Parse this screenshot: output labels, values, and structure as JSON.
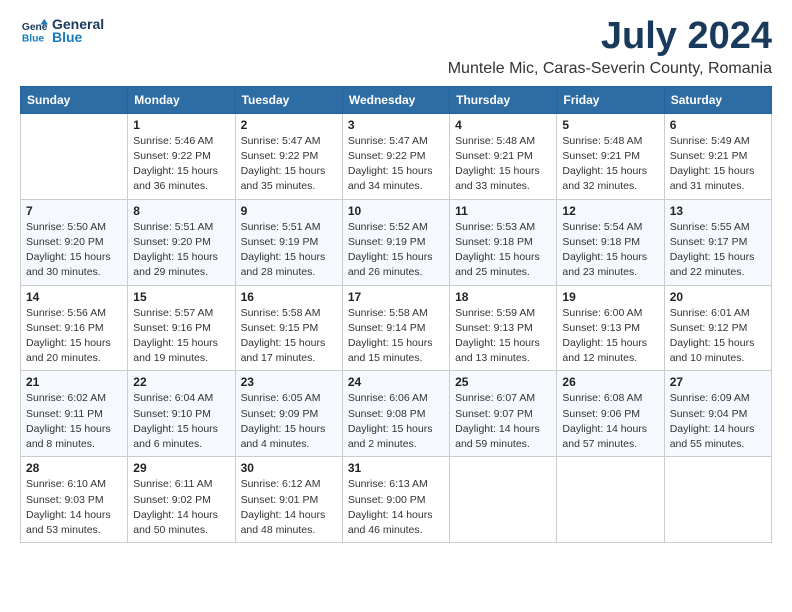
{
  "header": {
    "logo_line1": "General",
    "logo_line2": "Blue",
    "month": "July 2024",
    "location": "Muntele Mic, Caras-Severin County, Romania"
  },
  "weekdays": [
    "Sunday",
    "Monday",
    "Tuesday",
    "Wednesday",
    "Thursday",
    "Friday",
    "Saturday"
  ],
  "weeks": [
    [
      {
        "day": "",
        "info": ""
      },
      {
        "day": "1",
        "info": "Sunrise: 5:46 AM\nSunset: 9:22 PM\nDaylight: 15 hours\nand 36 minutes."
      },
      {
        "day": "2",
        "info": "Sunrise: 5:47 AM\nSunset: 9:22 PM\nDaylight: 15 hours\nand 35 minutes."
      },
      {
        "day": "3",
        "info": "Sunrise: 5:47 AM\nSunset: 9:22 PM\nDaylight: 15 hours\nand 34 minutes."
      },
      {
        "day": "4",
        "info": "Sunrise: 5:48 AM\nSunset: 9:21 PM\nDaylight: 15 hours\nand 33 minutes."
      },
      {
        "day": "5",
        "info": "Sunrise: 5:48 AM\nSunset: 9:21 PM\nDaylight: 15 hours\nand 32 minutes."
      },
      {
        "day": "6",
        "info": "Sunrise: 5:49 AM\nSunset: 9:21 PM\nDaylight: 15 hours\nand 31 minutes."
      }
    ],
    [
      {
        "day": "7",
        "info": "Sunrise: 5:50 AM\nSunset: 9:20 PM\nDaylight: 15 hours\nand 30 minutes."
      },
      {
        "day": "8",
        "info": "Sunrise: 5:51 AM\nSunset: 9:20 PM\nDaylight: 15 hours\nand 29 minutes."
      },
      {
        "day": "9",
        "info": "Sunrise: 5:51 AM\nSunset: 9:19 PM\nDaylight: 15 hours\nand 28 minutes."
      },
      {
        "day": "10",
        "info": "Sunrise: 5:52 AM\nSunset: 9:19 PM\nDaylight: 15 hours\nand 26 minutes."
      },
      {
        "day": "11",
        "info": "Sunrise: 5:53 AM\nSunset: 9:18 PM\nDaylight: 15 hours\nand 25 minutes."
      },
      {
        "day": "12",
        "info": "Sunrise: 5:54 AM\nSunset: 9:18 PM\nDaylight: 15 hours\nand 23 minutes."
      },
      {
        "day": "13",
        "info": "Sunrise: 5:55 AM\nSunset: 9:17 PM\nDaylight: 15 hours\nand 22 minutes."
      }
    ],
    [
      {
        "day": "14",
        "info": "Sunrise: 5:56 AM\nSunset: 9:16 PM\nDaylight: 15 hours\nand 20 minutes."
      },
      {
        "day": "15",
        "info": "Sunrise: 5:57 AM\nSunset: 9:16 PM\nDaylight: 15 hours\nand 19 minutes."
      },
      {
        "day": "16",
        "info": "Sunrise: 5:58 AM\nSunset: 9:15 PM\nDaylight: 15 hours\nand 17 minutes."
      },
      {
        "day": "17",
        "info": "Sunrise: 5:58 AM\nSunset: 9:14 PM\nDaylight: 15 hours\nand 15 minutes."
      },
      {
        "day": "18",
        "info": "Sunrise: 5:59 AM\nSunset: 9:13 PM\nDaylight: 15 hours\nand 13 minutes."
      },
      {
        "day": "19",
        "info": "Sunrise: 6:00 AM\nSunset: 9:13 PM\nDaylight: 15 hours\nand 12 minutes."
      },
      {
        "day": "20",
        "info": "Sunrise: 6:01 AM\nSunset: 9:12 PM\nDaylight: 15 hours\nand 10 minutes."
      }
    ],
    [
      {
        "day": "21",
        "info": "Sunrise: 6:02 AM\nSunset: 9:11 PM\nDaylight: 15 hours\nand 8 minutes."
      },
      {
        "day": "22",
        "info": "Sunrise: 6:04 AM\nSunset: 9:10 PM\nDaylight: 15 hours\nand 6 minutes."
      },
      {
        "day": "23",
        "info": "Sunrise: 6:05 AM\nSunset: 9:09 PM\nDaylight: 15 hours\nand 4 minutes."
      },
      {
        "day": "24",
        "info": "Sunrise: 6:06 AM\nSunset: 9:08 PM\nDaylight: 15 hours\nand 2 minutes."
      },
      {
        "day": "25",
        "info": "Sunrise: 6:07 AM\nSunset: 9:07 PM\nDaylight: 14 hours\nand 59 minutes."
      },
      {
        "day": "26",
        "info": "Sunrise: 6:08 AM\nSunset: 9:06 PM\nDaylight: 14 hours\nand 57 minutes."
      },
      {
        "day": "27",
        "info": "Sunrise: 6:09 AM\nSunset: 9:04 PM\nDaylight: 14 hours\nand 55 minutes."
      }
    ],
    [
      {
        "day": "28",
        "info": "Sunrise: 6:10 AM\nSunset: 9:03 PM\nDaylight: 14 hours\nand 53 minutes."
      },
      {
        "day": "29",
        "info": "Sunrise: 6:11 AM\nSunset: 9:02 PM\nDaylight: 14 hours\nand 50 minutes."
      },
      {
        "day": "30",
        "info": "Sunrise: 6:12 AM\nSunset: 9:01 PM\nDaylight: 14 hours\nand 48 minutes."
      },
      {
        "day": "31",
        "info": "Sunrise: 6:13 AM\nSunset: 9:00 PM\nDaylight: 14 hours\nand 46 minutes."
      },
      {
        "day": "",
        "info": ""
      },
      {
        "day": "",
        "info": ""
      },
      {
        "day": "",
        "info": ""
      }
    ]
  ]
}
